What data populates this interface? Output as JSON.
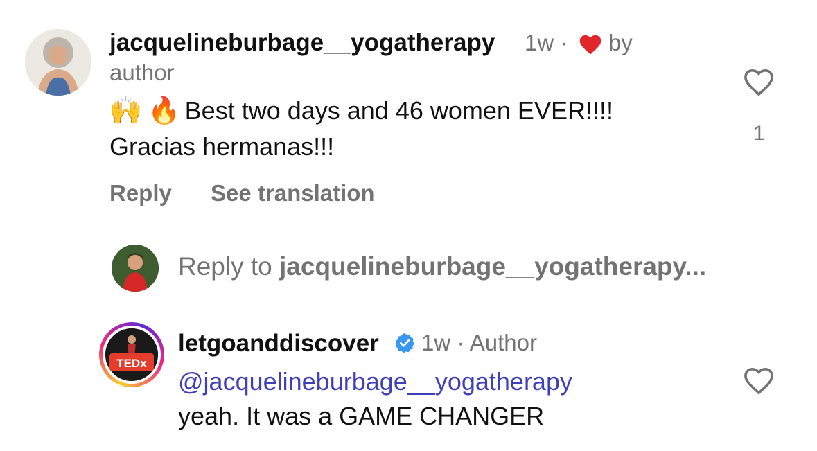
{
  "comment1": {
    "username": "jacquelineburbage__yogatherapy",
    "time": "1w",
    "dot": "·",
    "liked_by_label": "by",
    "liked_by_label2": "author",
    "emoji_1": "🙌",
    "emoji_2": "🔥",
    "text_line1": "Best two days and 46 women EVER!!!!",
    "text_line2": "Gracias hermanas!!!",
    "like_count": "1",
    "reply_label": "Reply",
    "translate_label": "See translation",
    "heart_color": "#e0262b"
  },
  "reply_box": {
    "prefix": "Reply to",
    "target": "jacquelineburbage__yogatherapy..."
  },
  "comment2": {
    "username": "letgoanddiscover",
    "verified_icon": "verified-badge-icon",
    "time": "1w",
    "dot": "·",
    "author_tag": "Author",
    "mention": "@jacquelineburbage__yogatherapy",
    "text": "yeah. It was a GAME CHANGER",
    "avatar_badge": "TEDx"
  },
  "colors": {
    "verified_blue": "#3897f0",
    "mention_color": "#3f3fb8",
    "muted": "#737373"
  }
}
